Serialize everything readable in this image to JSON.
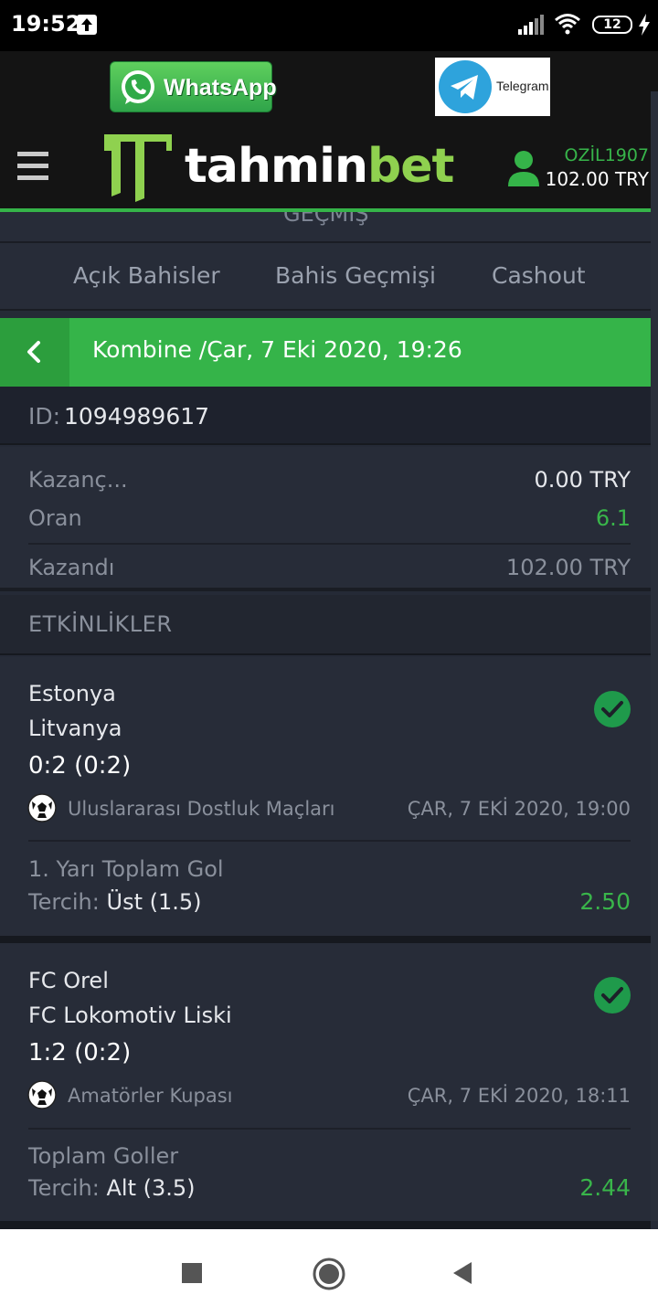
{
  "status_bar": {
    "time": "19:52",
    "battery": "12"
  },
  "header": {
    "whatsapp_label": "WhatsApp",
    "telegram_label": "Telegram",
    "brand_part1": "tahmin",
    "brand_part2": "bet",
    "account_name": "OZİL1907",
    "account_balance": "102.00 TRY"
  },
  "section_ghost": "GEÇMİŞ",
  "tabs": [
    "Açık Bahisler",
    "Bahis Geçmişi",
    "Cashout"
  ],
  "slip": {
    "title": "Kombine /Çar, 7 Eki 2020, 19:26",
    "id_label": "ID:",
    "id_value": "1094989617"
  },
  "summary": {
    "payout_label": "Kazanç...",
    "payout_value": "0.00 TRY",
    "odds_label": "Oran",
    "odds_value": "6.1",
    "won_label": "Kazandı",
    "won_value": "102.00 TRY"
  },
  "events_title": "ETKİNLİKLER",
  "events": [
    {
      "home": "Estonya",
      "away": "Litvanya",
      "score": "0:2 (0:2)",
      "league": "Uluslararası Dostluk Maçları",
      "date": "ÇAR, 7 EKİ 2020, 19:00",
      "market": "1. Yarı Toplam Gol",
      "choice_label": "Tercih:",
      "choice_value": "Üst (1.5)",
      "odd": "2.50"
    },
    {
      "home": "FC Orel",
      "away": "FC Lokomotiv Liski",
      "score": "1:2 (0:2)",
      "league": "Amatörler Kupası",
      "date": "ÇAR, 7 EKİ 2020, 18:11",
      "market": "Toplam Goller",
      "choice_label": "Tercih:",
      "choice_value": "Alt (3.5)",
      "odd": "2.44"
    }
  ],
  "colors": {
    "accent_green": "#35b449",
    "background": "#252a36",
    "header_bg": "#141414"
  }
}
